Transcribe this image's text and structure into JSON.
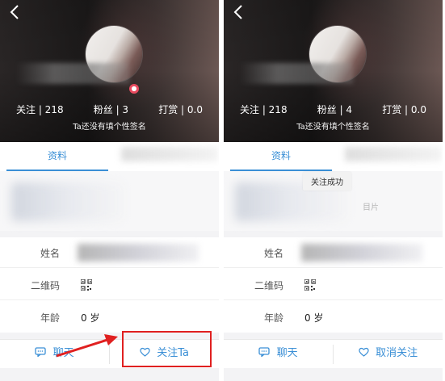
{
  "left": {
    "back": "<",
    "stats": {
      "follow": "关注 | 218",
      "fans": "粉丝 | 3",
      "reward": "打赏 | 0.0"
    },
    "signature": "Ta还没有填个性签名",
    "tab_profile": "资料",
    "labels": {
      "name": "姓名",
      "qrcode": "二维码",
      "age": "年龄"
    },
    "age_value": "0 岁",
    "buttons": {
      "chat": "聊天",
      "follow": "关注Ta"
    }
  },
  "right": {
    "back": "<",
    "stats": {
      "follow": "关注 | 218",
      "fans": "粉丝 | 4",
      "reward": "打赏 | 0.0"
    },
    "signature": "Ta还没有填个性签名",
    "tab_profile": "资料",
    "toast": "关注成功",
    "photo_hint": "目片",
    "labels": {
      "name": "姓名",
      "qrcode": "二维码",
      "age": "年龄"
    },
    "age_value": "0 岁",
    "buttons": {
      "chat": "聊天",
      "unfollow": "取消关注"
    }
  },
  "colors": {
    "accent": "#3a8fd6",
    "highlight": "#e02020",
    "location_pin": "#e84a5f"
  },
  "icons": [
    "back-icon",
    "location-pin-icon",
    "qr-code-icon",
    "chat-icon",
    "heart-icon"
  ]
}
